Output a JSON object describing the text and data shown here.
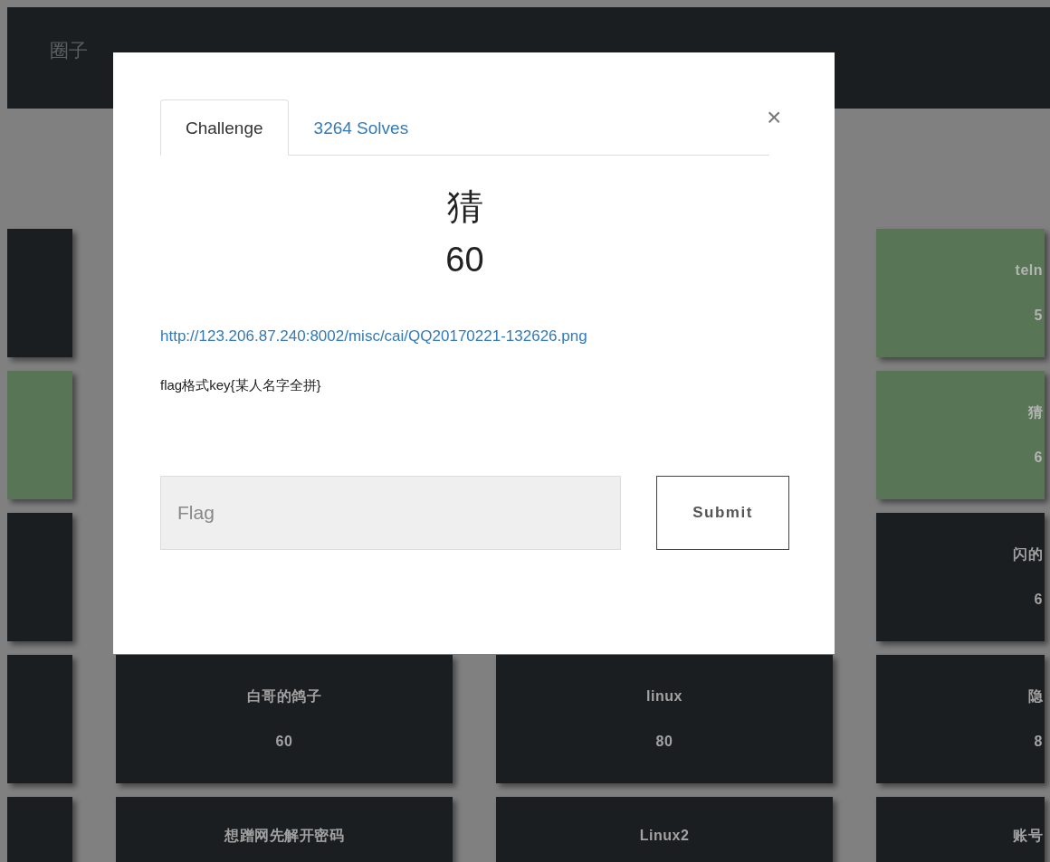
{
  "nav": {
    "items": [
      {
        "label": "圈子"
      }
    ]
  },
  "board": {
    "rows": [
      {
        "cards": [
          {
            "kind": "left-edge",
            "solved": false
          },
          {
            "kind": "right-edge",
            "solved": true,
            "name": "teln",
            "points": "5"
          }
        ]
      },
      {
        "cards": [
          {
            "kind": "left-edge",
            "solved": true
          },
          {
            "kind": "right-edge",
            "solved": true,
            "name": "猜",
            "points": "6"
          }
        ]
      },
      {
        "cards": [
          {
            "kind": "left-edge",
            "solved": false
          },
          {
            "kind": "right-edge",
            "solved": false,
            "name": "闪的",
            "points": "6"
          }
        ]
      },
      {
        "cards": [
          {
            "kind": "left-edge",
            "solved": false
          },
          {
            "kind": "middle",
            "solved": false,
            "name": "白哥的鸽子",
            "points": "60"
          },
          {
            "kind": "middle",
            "solved": false,
            "name": "linux",
            "points": "80"
          },
          {
            "kind": "right-edge",
            "solved": false,
            "name": "隐",
            "points": "8"
          }
        ]
      },
      {
        "cards": [
          {
            "kind": "left-edge",
            "solved": false
          },
          {
            "kind": "middle",
            "solved": false,
            "name": "想蹭网先解开密码"
          },
          {
            "kind": "middle",
            "solved": false,
            "name": "Linux2"
          },
          {
            "kind": "right-edge",
            "solved": false,
            "name": "账号"
          }
        ]
      }
    ]
  },
  "modal": {
    "tabs": [
      {
        "label": "Challenge",
        "selected": true
      },
      {
        "label": "3264 Solves",
        "selected": false
      }
    ],
    "close": "×",
    "title": "猜",
    "points": "60",
    "link": "http://123.206.87.240:8002/misc/cai/QQ20170221-132626.png",
    "description": "flag格式key{某人名字全拼}",
    "flag_field": {
      "placeholder": "Flag"
    },
    "submit": "Submit"
  }
}
